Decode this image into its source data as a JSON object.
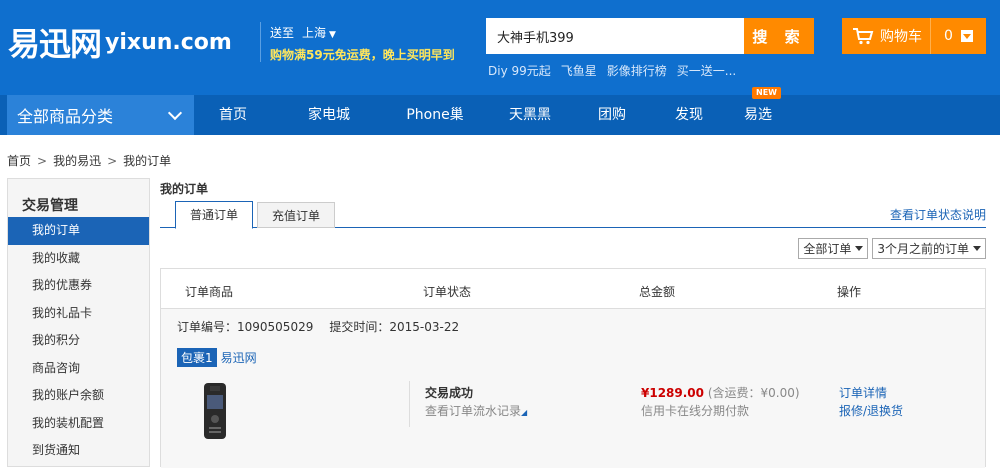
{
  "header": {
    "logo_cn": "易迅网",
    "logo_en": "yixun.com",
    "deliver_label": "送至",
    "city": "上海",
    "promo": "购物满59元免运费，晚上买明早到",
    "search_value": "大神手机399",
    "search_button": "搜 索",
    "hot_words": [
      "Diy 99元起",
      "飞鱼星",
      "影像排行榜",
      "买一送一..."
    ],
    "cart_label": "购物车",
    "cart_count": "0"
  },
  "nav": {
    "all_categories": "全部商品分类",
    "items": [
      "首页",
      "家电城",
      "Phone巢",
      "天黑黑",
      "团购",
      "发现",
      "易选"
    ],
    "new_badge": "NEW"
  },
  "breadcrumb": [
    "首页",
    "我的易迅",
    "我的订单"
  ],
  "sidebar": {
    "title": "交易管理",
    "items": [
      "我的订单",
      "我的收藏",
      "我的优惠券",
      "我的礼品卡",
      "我的积分",
      "商品咨询",
      "我的账户余额",
      "我的装机配置",
      "到货通知"
    ]
  },
  "main": {
    "title": "我的订单",
    "tabs": [
      "普通订单",
      "充值订单"
    ],
    "status_link": "查看订单状态说明",
    "filters": [
      "全部订单",
      "3个月之前的订单"
    ],
    "columns": [
      "订单商品",
      "订单状态",
      "总金额",
      "操作"
    ]
  },
  "order": {
    "number_label": "订单编号：1090505029",
    "time_label": "提交时间：2015-03-22",
    "package": "包裹1",
    "seller": "易迅网",
    "status": "交易成功",
    "status_sub": "查看订单流水记录",
    "price": "¥1289.00",
    "shipping": "(含运费：¥0.00)",
    "payment": "信用卡在线分期付款",
    "actions": [
      "订单详情",
      "报修/退换货"
    ]
  },
  "colors": {
    "header_bg": "#0f6fce",
    "nav_bg": "#0a60b6",
    "accent_orange": "#ff8a00",
    "link_blue": "#1b64b6",
    "price_red": "#cc0000"
  }
}
